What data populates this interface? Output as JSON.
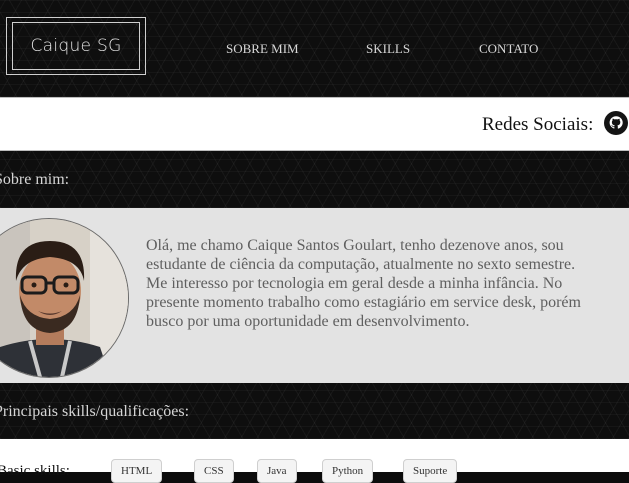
{
  "header": {
    "logo_text": "Caique SG",
    "nav": [
      {
        "label": "SOBRE MIM"
      },
      {
        "label": "SKILLS"
      },
      {
        "label": "CONTATO"
      }
    ]
  },
  "social": {
    "label": "Redes Sociais:",
    "icons": [
      "github-icon"
    ]
  },
  "about": {
    "section_title": "Sobre mim:",
    "lines": [
      "Olá, me chamo Caique Santos Goulart, tenho dezenove anos, sou",
      "estudante de ciência da computação, atualmente no sexto semestre.",
      "Me interesso por tecnologia em geral desde a minha infância. No",
      "presente momento trabalho como estagiário em service desk, porém",
      "busco por uma oportunidade em desenvolvimento."
    ]
  },
  "skills": {
    "section_title": "Principais skills/qualificações:",
    "basic_label": "Basic skills:",
    "items": [
      "HTML",
      "CSS",
      "Java",
      "Python",
      "Suporte"
    ]
  },
  "colors": {
    "header_bg": "#0e0e0e",
    "about_bg": "#e3e3e3",
    "about_text": "#5f5f5f",
    "nav_text": "#d8d8d8"
  }
}
